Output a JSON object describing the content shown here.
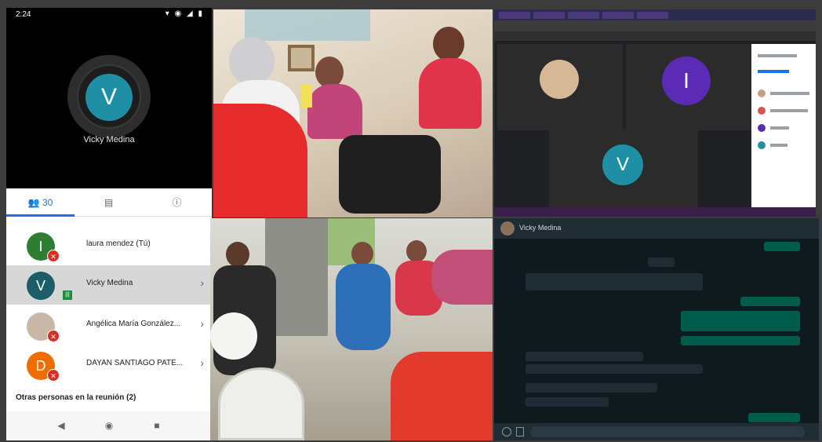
{
  "phone": {
    "status_time": "2:24",
    "status_icons": "▾ ◉ ◢ ▮",
    "callee_initial": "V",
    "callee_name": "Vicky Medina",
    "tabs": [
      {
        "label": "👥 30",
        "icon": "people-icon"
      },
      {
        "label": "▤",
        "icon": "chat-icon"
      },
      {
        "label": "ⓘ",
        "icon": "info-icon"
      }
    ],
    "participants": [
      {
        "initial": "I",
        "name": "laura mendez (Tú)",
        "color": "#2e7d32",
        "muted": true
      },
      {
        "initial": "V",
        "name": "Vicky Medina",
        "color": "#1b5e6a",
        "muted": false
      },
      {
        "initial": "",
        "name": "Angélica María González...",
        "color": "#c9b8a8",
        "muted": true
      },
      {
        "initial": "D",
        "name": "DAYAN SANTIAGO PATE...",
        "color": "#ef6c00",
        "muted": true
      }
    ],
    "others_label": "Otras personas en la reunión (2)",
    "nav": [
      "◀",
      "◉",
      "■"
    ]
  },
  "desktop_meet": {
    "avatar_b_initial": "I",
    "avatar_c_initial": "V",
    "avatar_b_color": "#5b2bb5",
    "avatar_c_color": "#1f8fa6"
  },
  "whatsapp": {
    "contact_name": "Vicky Medina"
  }
}
